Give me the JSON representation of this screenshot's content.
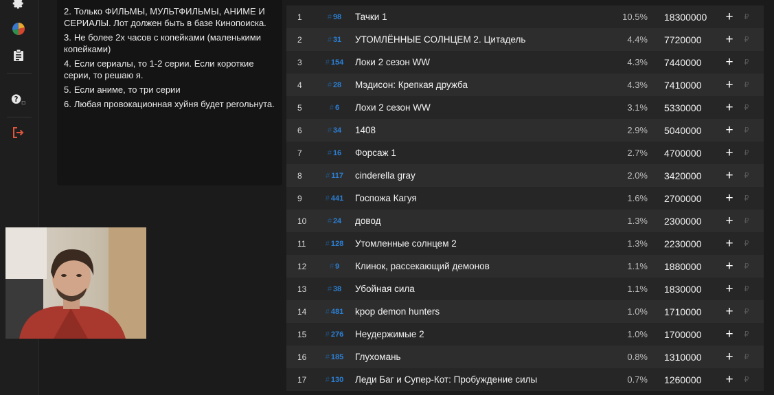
{
  "sidebar": {
    "icons": [
      "gear-icon",
      "pie-chart-icon",
      "clipboard-icon",
      "help-icon",
      "logout-icon"
    ]
  },
  "rules": {
    "items": [
      {
        "num": "2.",
        "text": "Только ФИЛЬМЫ, МУЛЬТФИЛЬМЫ, АНИМЕ И СЕРИАЛЫ. Лот должен быть в базе Кинопоиска."
      },
      {
        "num": "3.",
        "text": "Не более 2х часов с копейками (маленькими копейками)"
      },
      {
        "num": "4.",
        "text": "Если сериалы, то 1-2 серии. Если короткие серии, то решаю я."
      },
      {
        "num": "5.",
        "text": "Если аниме, то три серии"
      },
      {
        "num": "6.",
        "text": "Любая провокационная хуйня будет perольнута."
      }
    ]
  },
  "table": {
    "hash_symbol": "#",
    "plus_label": "+",
    "coin_symbol": "₽",
    "rows": [
      {
        "idx": "1",
        "id": "98",
        "title": "Тачки 1",
        "pct": "10.5%",
        "amount": "18300000"
      },
      {
        "idx": "2",
        "id": "31",
        "title": "УТОМЛЁННЫЕ СОЛНЦЕМ 2. Цитадель",
        "pct": "4.4%",
        "amount": "7720000"
      },
      {
        "idx": "3",
        "id": "154",
        "title": "Локи 2 сезон WW",
        "pct": "4.3%",
        "amount": "7440000"
      },
      {
        "idx": "4",
        "id": "28",
        "title": "Мэдисон: Крепкая дружба",
        "pct": "4.3%",
        "amount": "7410000"
      },
      {
        "idx": "5",
        "id": "6",
        "title": "Лохи 2 сезон WW",
        "pct": "3.1%",
        "amount": "5330000"
      },
      {
        "idx": "6",
        "id": "34",
        "title": "1408",
        "pct": "2.9%",
        "amount": "5040000"
      },
      {
        "idx": "7",
        "id": "16",
        "title": "Форсаж 1",
        "pct": "2.7%",
        "amount": "4700000"
      },
      {
        "idx": "8",
        "id": "117",
        "title": "cinderella gray",
        "pct": "2.0%",
        "amount": "3420000"
      },
      {
        "idx": "9",
        "id": "441",
        "title": "Госпожа Кагуя",
        "pct": "1.6%",
        "amount": "2700000"
      },
      {
        "idx": "10",
        "id": "24",
        "title": "довод",
        "pct": "1.3%",
        "amount": "2300000"
      },
      {
        "idx": "11",
        "id": "128",
        "title": "Утомленные солнцем 2",
        "pct": "1.3%",
        "amount": "2230000"
      },
      {
        "idx": "12",
        "id": "9",
        "title": "Клинок, рассекающий демонов",
        "pct": "1.1%",
        "amount": "1880000"
      },
      {
        "idx": "13",
        "id": "38",
        "title": "Убойная сила",
        "pct": "1.1%",
        "amount": "1830000"
      },
      {
        "idx": "14",
        "id": "481",
        "title": "kpop demon hunters",
        "pct": "1.0%",
        "amount": "1710000"
      },
      {
        "idx": "15",
        "id": "276",
        "title": "Неудержимые 2",
        "pct": "1.0%",
        "amount": "1700000"
      },
      {
        "idx": "16",
        "id": "185",
        "title": "Глухомань",
        "pct": "0.8%",
        "amount": "1310000"
      },
      {
        "idx": "17",
        "id": "130",
        "title": "Леди Баг и Супер-Кот: Пробуждение силы",
        "pct": "0.7%",
        "amount": "1260000"
      }
    ]
  },
  "colors": {
    "id_blue": "#2b7fd4",
    "logout_red": "#e0553d"
  }
}
